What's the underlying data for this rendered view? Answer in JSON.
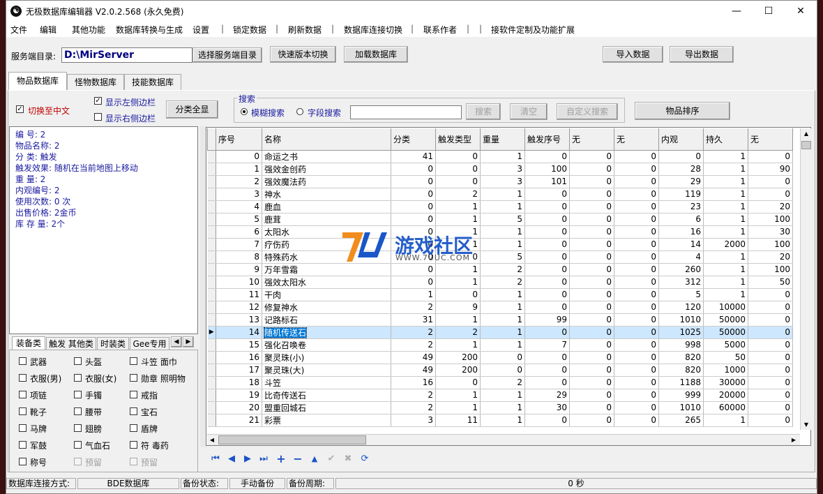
{
  "window": {
    "title": "无极数据库编辑器 V2.0.2.568 (永久免费)",
    "app_icon": "yin-yang-icon"
  },
  "menu": [
    "文件",
    "编辑",
    "其他功能",
    "数据库转换与生成",
    "设置",
    "锁定数据",
    "刷新数据",
    "数据库连接切换",
    "联系作者",
    "接软件定制及功能扩展"
  ],
  "toolbar": {
    "server_dir_label": "服务端目录:",
    "server_dir_value": "D:\\MirServer",
    "choose_dir_label": "选择服务端目录",
    "quick_switch_label": "快速版本切换",
    "load_db_label": "加载数据库",
    "import_label": "导入数据",
    "export_label": "导出数据"
  },
  "tabs": [
    "物品数据库",
    "怪物数据库",
    "技能数据库"
  ],
  "options": {
    "switch_chinese": "切换至中文",
    "show_left": "显示左侧边栏",
    "show_right": "显示右侧边栏",
    "show_all_label": "分类全显"
  },
  "search": {
    "group_label": "搜索",
    "fuzzy": "模糊搜索",
    "field": "字段搜索",
    "search_btn": "搜索",
    "clear_btn": "清空",
    "custom_btn": "自定义搜索",
    "sort_btn": "物品排序"
  },
  "detail": [
    "编    号: 2",
    "物品名称: 2",
    "分    类: 触发",
    "触发效果: 随机在当前地图上移动",
    "重    量: 2",
    "内观编号: 2",
    "使用次数: 0 次",
    "出售价格: 2金币",
    "库 存 量: 2个"
  ],
  "cat_tabs": [
    "装备类",
    "触发 其他类",
    "时装类",
    "Gee专用"
  ],
  "categories": [
    [
      "武器",
      "头盔",
      "斗笠 面巾"
    ],
    [
      "衣服(男)",
      "衣服(女)",
      "勋章 照明物"
    ],
    [
      "项链",
      "手镯",
      "戒指"
    ],
    [
      "靴子",
      "腰带",
      "宝石"
    ],
    [
      "马牌",
      "翅膀",
      "盾牌"
    ],
    [
      "军鼓",
      "气血石",
      "符 毒药"
    ],
    [
      "称号",
      "预留",
      "预留"
    ]
  ],
  "grid": {
    "columns": [
      "序号",
      "名称",
      "分类",
      "触发类型",
      "重量",
      "触发序号",
      "无",
      "无",
      "内观",
      "持久",
      "无"
    ],
    "rows": [
      [
        0,
        "命运之书",
        41,
        0,
        1,
        0,
        0,
        0,
        0,
        1,
        0
      ],
      [
        1,
        "强效金创药",
        0,
        0,
        3,
        100,
        0,
        0,
        28,
        1,
        90
      ],
      [
        2,
        "强效魔法药",
        0,
        0,
        3,
        101,
        0,
        0,
        29,
        1,
        0
      ],
      [
        3,
        "神水",
        0,
        2,
        1,
        0,
        0,
        0,
        119,
        1,
        0
      ],
      [
        4,
        "鹿血",
        0,
        1,
        1,
        0,
        0,
        0,
        23,
        1,
        20
      ],
      [
        5,
        "鹿茸",
        0,
        1,
        5,
        0,
        0,
        0,
        6,
        1,
        100
      ],
      [
        6,
        "太阳水",
        0,
        1,
        1,
        0,
        0,
        0,
        16,
        1,
        30
      ],
      [
        7,
        "疗伤药",
        0,
        1,
        1,
        0,
        0,
        0,
        14,
        2000,
        100
      ],
      [
        8,
        "特殊药水",
        0,
        0,
        5,
        0,
        0,
        0,
        4,
        1,
        20
      ],
      [
        9,
        "万年雪霜",
        0,
        1,
        2,
        0,
        0,
        0,
        260,
        1,
        100
      ],
      [
        10,
        "强效太阳水",
        0,
        1,
        2,
        0,
        0,
        0,
        312,
        1,
        50
      ],
      [
        11,
        "干肉",
        1,
        0,
        1,
        0,
        0,
        0,
        5,
        1,
        0
      ],
      [
        12,
        "修复神水",
        2,
        9,
        1,
        0,
        0,
        0,
        120,
        10000,
        0
      ],
      [
        13,
        "记路标石",
        31,
        1,
        1,
        99,
        0,
        0,
        1010,
        50000,
        0
      ],
      [
        14,
        "随机传送石",
        2,
        2,
        1,
        0,
        0,
        0,
        1025,
        50000,
        0
      ],
      [
        15,
        "强化召唤卷",
        2,
        1,
        1,
        7,
        0,
        0,
        998,
        5000,
        0
      ],
      [
        16,
        "聚灵珠(小)",
        49,
        200,
        0,
        0,
        0,
        0,
        820,
        50,
        0
      ],
      [
        17,
        "聚灵珠(大)",
        49,
        200,
        0,
        0,
        0,
        0,
        820,
        1000,
        0
      ],
      [
        18,
        "斗笠",
        16,
        0,
        2,
        0,
        0,
        0,
        1188,
        30000,
        0
      ],
      [
        19,
        "比奇传送石",
        2,
        1,
        1,
        29,
        0,
        0,
        999,
        20000,
        0
      ],
      [
        20,
        "盟重回城石",
        2,
        1,
        1,
        30,
        0,
        0,
        1010,
        60000,
        0
      ],
      [
        21,
        "彩票",
        3,
        11,
        1,
        0,
        0,
        0,
        265,
        1,
        0
      ]
    ],
    "selected_index": 14
  },
  "watermark": {
    "brand": "游戏社区",
    "url": "WWW.7UUC.COM"
  },
  "status": {
    "conn_label": "数据库连接方式:",
    "conn_value": "BDE数据库",
    "backup_label": "备份状态:",
    "backup_value": "手动备份",
    "period_label": "备份周期:",
    "period_value": "0 秒"
  },
  "colors": {
    "accent_blue": "#0078d7",
    "label_blue": "#1a1aa0",
    "option_red": "#c00000"
  }
}
